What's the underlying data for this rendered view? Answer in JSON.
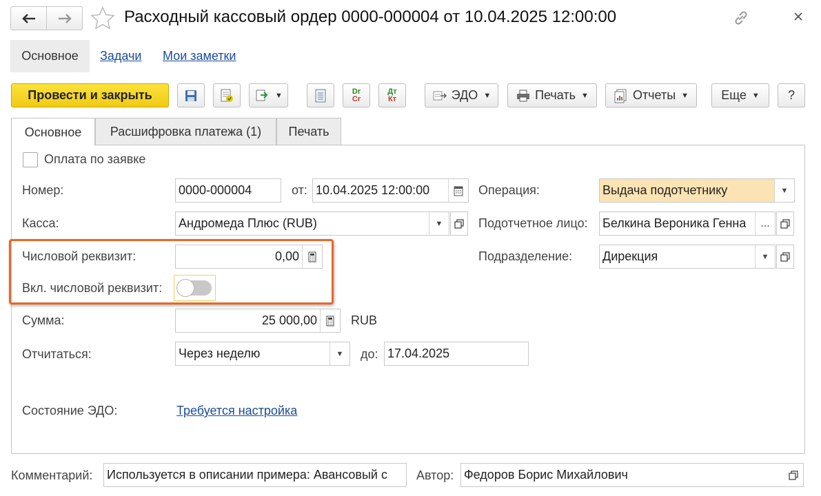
{
  "window": {
    "title": "Расходный кассовый ордер 0000-000004 от 10.04.2025 12:00:00",
    "back_icon": "arrow-left-icon",
    "forward_icon": "arrow-right-icon",
    "favorite_icon": "star-icon",
    "link_icon": "link-icon",
    "close_icon": "close-icon"
  },
  "top_tabs": {
    "main": "Основное",
    "tasks": "Задачи",
    "notes": "Мои заметки"
  },
  "toolbar": {
    "post_close": "Провести и закрыть",
    "edo": "ЭДО",
    "print": "Печать",
    "reports": "Отчеты",
    "more": "Еще",
    "help": "?",
    "dr_top": "Dr",
    "dr_bottom": "Cr",
    "dt_top": "Дт",
    "dt_bottom": "Кт"
  },
  "form_tabs": [
    "Основное",
    "Расшифровка платежа (1)",
    "Печать"
  ],
  "form": {
    "pay_by_request": {
      "label": "Оплата по заявке",
      "checked": false
    },
    "number": {
      "label": "Номер:",
      "value": "0000-000004"
    },
    "date": {
      "label": "от:",
      "value": "10.04.2025 12:00:00"
    },
    "operation": {
      "label": "Операция:",
      "value": "Выдача подотчетнику"
    },
    "kassa": {
      "label": "Касса:",
      "value": "Андромеда Плюс (RUB)"
    },
    "accountable": {
      "label": "Подотчетное лицо:",
      "value": "Белкина Вероника Генна",
      "more": "..."
    },
    "numeric_attr": {
      "label": "Числовой реквизит:",
      "value": "0,00"
    },
    "division": {
      "label": "Подразделение:",
      "value": "Дирекция"
    },
    "numeric_toggle": {
      "label": "Вкл. числовой реквизит:",
      "on": false
    },
    "sum": {
      "label": "Сумма:",
      "value": "25 000,00",
      "currency": "RUB"
    },
    "report": {
      "label": "Отчитаться:",
      "value": "Через неделю",
      "until_label": "до:",
      "until_value": "17.04.2025"
    },
    "edo_state": {
      "label": "Состояние ЭДО:",
      "value": "Требуется настройка"
    }
  },
  "footer": {
    "comment_label": "Комментарий:",
    "comment_value": "Используется в описании примера: Авансовый с",
    "author_label": "Автор:",
    "author_value": "Федоров Борис Михайлович"
  },
  "colors": {
    "primary_button": "#f5d41f",
    "operation_bg": "#fbe3b3",
    "highlight_border": "#e8682a",
    "link": "#1a4c9b"
  }
}
